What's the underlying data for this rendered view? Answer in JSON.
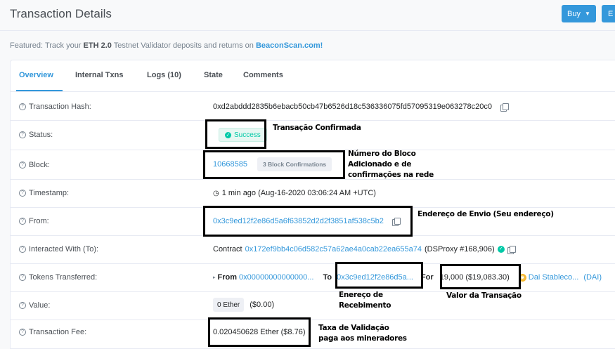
{
  "header": {
    "title": "Transaction Details",
    "buy_label": "Buy",
    "second_label": "E"
  },
  "featured": {
    "prefix": "Featured: Track your ",
    "bold": "ETH 2.0",
    "middle": " Testnet Validator deposits and returns on ",
    "link": "BeaconScan.com!"
  },
  "tabs": [
    "Overview",
    "Internal Txns",
    "Logs (10)",
    "State",
    "Comments"
  ],
  "rows": {
    "hash": {
      "label": "Transaction Hash:",
      "value": "0xd2abddd2835b6ebacb50cb47b6526d18c536336075fd57095319e063278c20c0"
    },
    "status": {
      "label": "Status:",
      "value": "Success"
    },
    "block": {
      "label": "Block:",
      "value": "10668585",
      "confirmations": "3 Block Confirmations"
    },
    "timestamp": {
      "label": "Timestamp:",
      "value": "1 min ago (Aug-16-2020 03:06:24 AM +UTC)"
    },
    "from": {
      "label": "From:",
      "value": "0x3c9ed12f2e86d5a6f63852d2d2f3851af538c5b2"
    },
    "interacted": {
      "label": "Interacted With (To):",
      "prefix": "Contract",
      "contract": "0x172ef9bb4c06d582c57a62ae4a0cab22ea655a74",
      "name": "(DSProxy #168,906)"
    },
    "tokens": {
      "label": "Tokens Transferred:",
      "from_label": "From",
      "from_value": "0x00000000000000...",
      "to_label": "To",
      "to_value": "0x3c9ed12f2e86d5a...",
      "for_label": "For",
      "amount": "19,000 ($19,083.30)",
      "token": "Dai Stableco...",
      "symbol": "(DAI)"
    },
    "value": {
      "label": "Value:",
      "ether": "0 Ether",
      "usd": "($0.00)"
    },
    "fee": {
      "label": "Transaction Fee:",
      "value": "0.020450628 Ether ($8.76)"
    }
  },
  "annotations": {
    "status": "Transação Confirmada",
    "block_1": "Número do Bloco",
    "block_2": "Adicionado e de",
    "block_3": "confirmações na rede",
    "from": "Endereço de Envio (Seu endereço)",
    "to_1": "Enereço de",
    "to_2": "Recebimento",
    "amount": "Valor da Transação",
    "fee_1": "Taxa de Validação",
    "fee_2": "paga aos mineradores"
  }
}
